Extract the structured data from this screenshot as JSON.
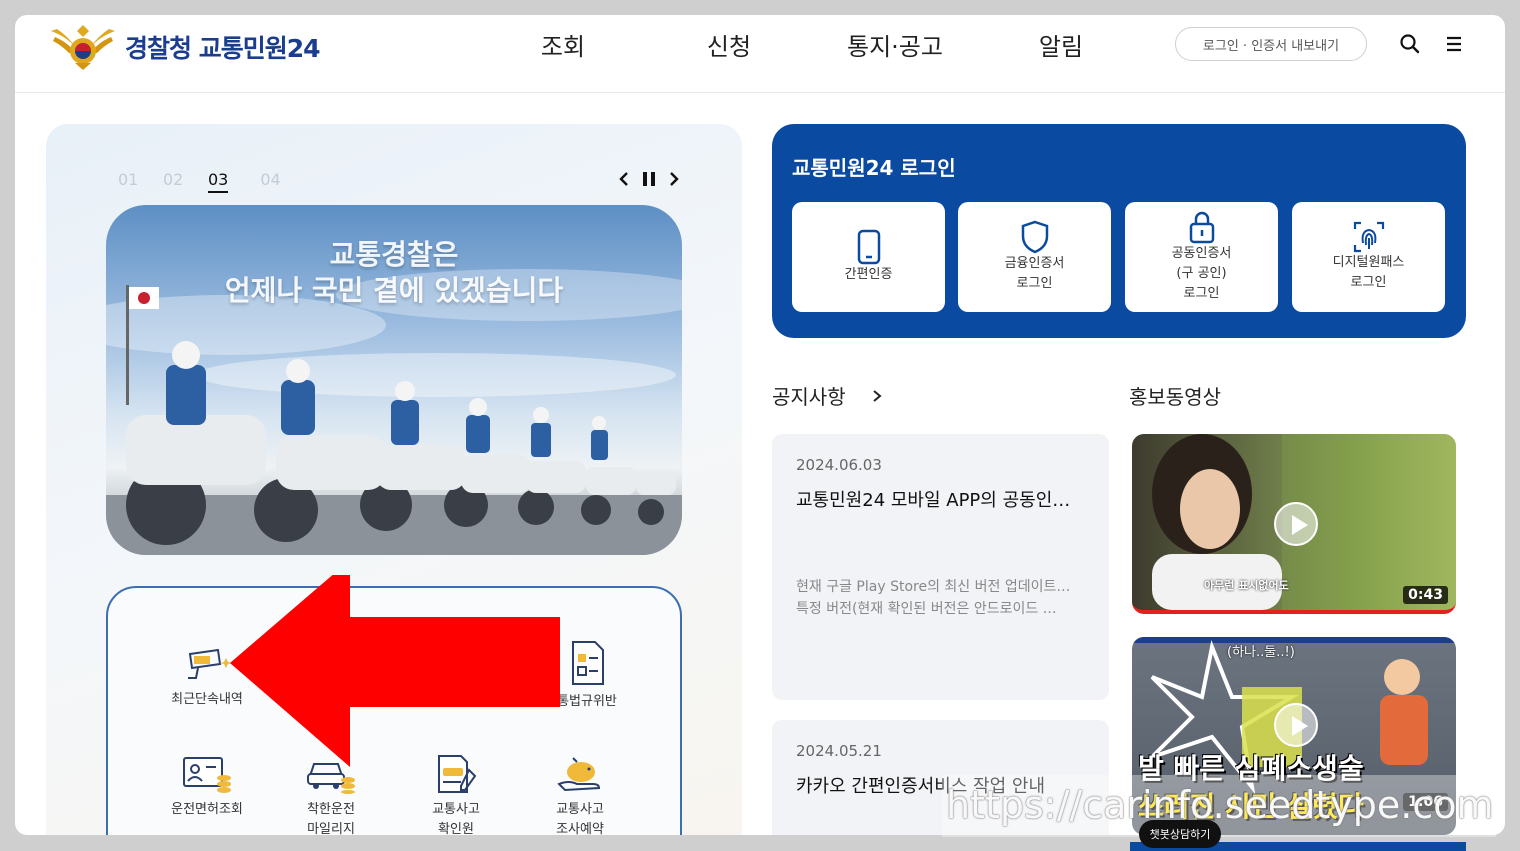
{
  "header": {
    "logo_text": "경찰청 교통민원24",
    "nav": [
      "조회",
      "신청",
      "통지·공고",
      "알림"
    ],
    "login_button": "로그인 · 인증서 내보내기",
    "icons": [
      "search-icon",
      "menu-icon"
    ]
  },
  "slider": {
    "numbers": [
      "01",
      "02",
      "03",
      "04"
    ],
    "active_index": 2,
    "banner_line1": "교통경찰은",
    "banner_line2": "언제나 국민 곁에 있겠습니다"
  },
  "services": {
    "recent_enforcement": "최근단속내역",
    "traffic_violation": "통법규위반",
    "license_lookup": "운전면허조회",
    "safe_driving_line1": "착한운전",
    "safe_driving_line2": "마일리지",
    "accident_cert_line1": "교통사고",
    "accident_cert_line2": "확인원",
    "accident_reserve_line1": "교통사고",
    "accident_reserve_line2": "조사예약"
  },
  "login": {
    "title": "교통민원24 로그인",
    "card1": "간편인증",
    "card2_line1": "금융인증서",
    "card2_line2": "로그인",
    "card3_line1": "공동인증서",
    "card3_line2": "(구 공인)",
    "card3_line3": "로그인",
    "card4_line1": "디지털원패스",
    "card4_line2": "로그인"
  },
  "notices": {
    "title": "공지사항",
    "items": [
      {
        "date": "2024.06.03",
        "title": "교통민원24 모바일 APP의 공동인…",
        "body_line1": "현재 구글 Play Store의 최신 버전 업데이트…",
        "body_line2": "특정 버전(현재 확인된 버전은 안드로이드 …"
      },
      {
        "date": "2024.05.21",
        "title": "카카오 간편인증서비스 작업 안내"
      }
    ]
  },
  "videos": {
    "title": "홍보동영상",
    "items": [
      {
        "duration": "0:43",
        "caption": "아무런 표시없어도"
      },
      {
        "duration": "1:06",
        "caption_line1": "발 빠른 심폐소생술",
        "caption_line2": "쓰러진 시민 살렸다",
        "bubble": "(하나..둘..!)"
      }
    ]
  },
  "watermark": "https://carinfo.seedtype.com",
  "chatbot": "챗봇상담하기",
  "colors": {
    "primary": "#0a4aa0",
    "arrow": "#ff0000"
  }
}
